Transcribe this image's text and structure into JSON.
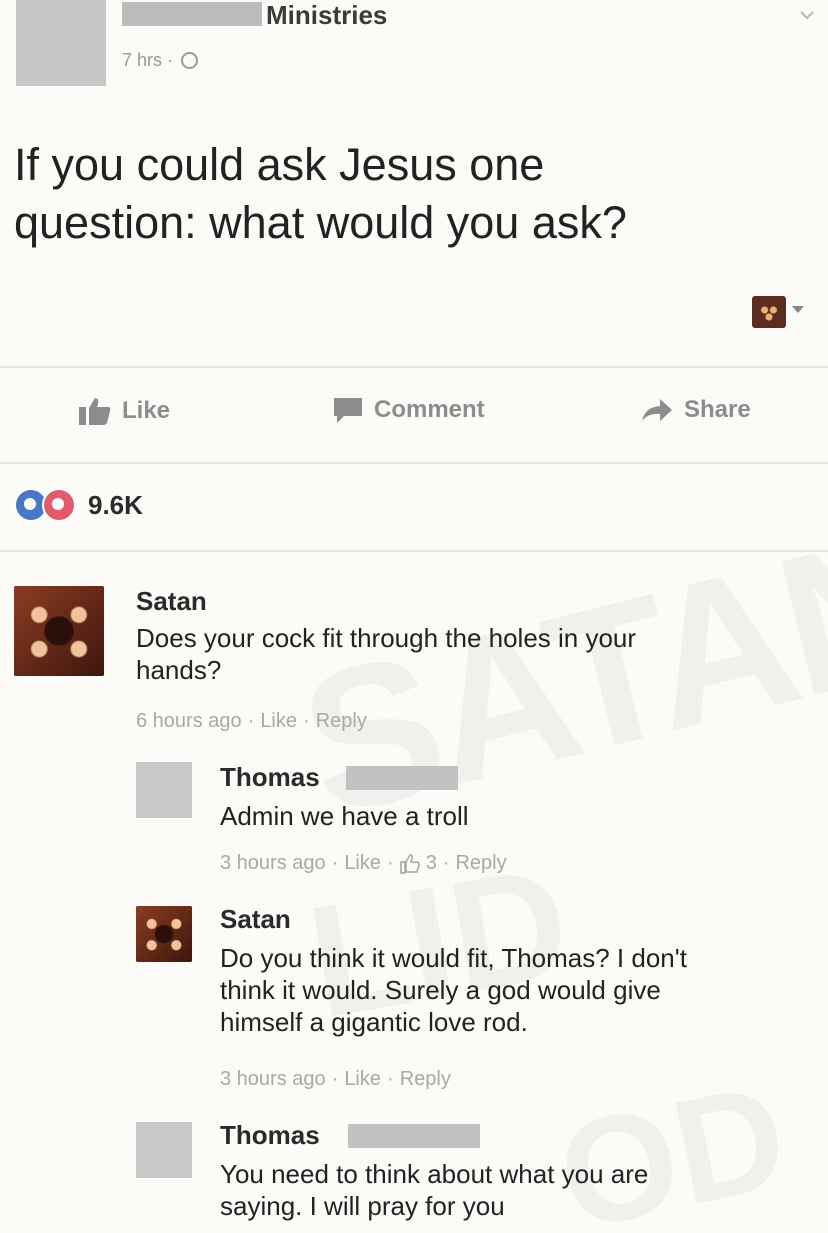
{
  "post": {
    "page_name": "Ministries",
    "time": "7 hrs ·",
    "text_line1": "If you could ask Jesus one",
    "text_line2": "question: what would you ask?"
  },
  "actions": {
    "like": "Like",
    "comment": "Comment",
    "share": "Share"
  },
  "reactions": {
    "count": "9.6K"
  },
  "watermark": {
    "word1": "SATAN",
    "word2": "LID",
    "word3": "OD"
  },
  "comments": [
    {
      "name": "Satan",
      "text_lines": [
        "Does your cock fit through the holes in your",
        "hands?"
      ],
      "meta": {
        "time": "6 hours ago",
        "like": "Like",
        "reply": "Reply"
      }
    },
    {
      "name": "Thomas",
      "text_lines": [
        "Admin we have a troll"
      ],
      "meta": {
        "time": "3 hours ago",
        "like": "Like",
        "likes_count": "3",
        "reply": "Reply"
      }
    },
    {
      "name": "Satan",
      "text_lines": [
        "Do you think it would fit, Thomas? I don't",
        "think it would. Surely a god would give",
        "himself a gigantic love rod."
      ],
      "meta": {
        "time": "3 hours ago",
        "like": "Like",
        "reply": "Reply"
      }
    },
    {
      "name": "Thomas",
      "text_lines": [
        "You need to think about what you are",
        "saying. I will pray for you"
      ]
    }
  ],
  "icons": {
    "globe": "globe-icon",
    "chevron": "chevron-down-icon",
    "like": "thumbs-up-icon",
    "comment": "comment-icon",
    "share": "share-arrow-icon",
    "like_reaction": "like-reaction-icon",
    "love_reaction": "love-reaction-icon"
  },
  "colors": {
    "like_blue": "#4a77c8",
    "love_red": "#e25a6b",
    "meta_gray": "#a8a8a8"
  }
}
